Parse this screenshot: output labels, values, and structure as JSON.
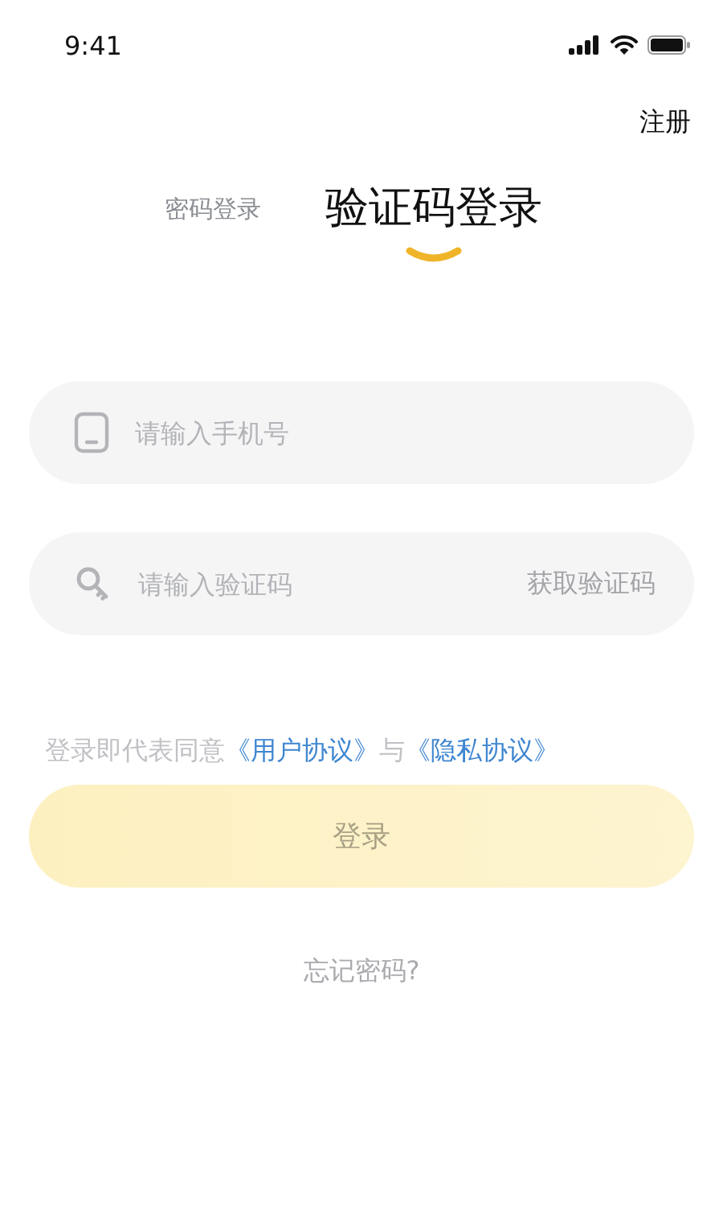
{
  "status_bar": {
    "time": "9:41"
  },
  "register_link": "注册",
  "tabs": [
    {
      "label": "密码登录",
      "selected": false
    },
    {
      "label": "验证码登录",
      "selected": true
    }
  ],
  "fields": [
    {
      "kind": "phone",
      "placeholder": "请输入手机号"
    },
    {
      "kind": "code",
      "placeholder": "请输入验证码",
      "action": "获取验证码"
    }
  ],
  "agreement": {
    "text": "登录即代表同意",
    "links": [
      "《用户协议》",
      "《隐私协议》"
    ],
    "joiner": "与"
  },
  "login_button": {
    "label": "登录",
    "disabled": true
  },
  "forgot_link": "忘记密码?"
}
